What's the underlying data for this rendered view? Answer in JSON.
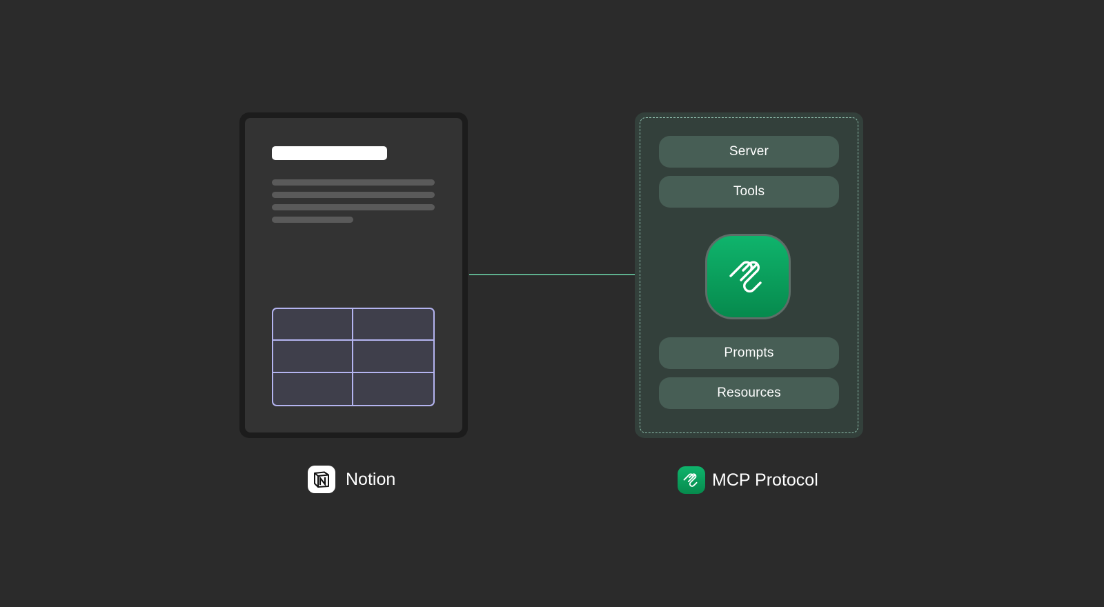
{
  "diagram": {
    "source": {
      "label": "Notion",
      "icon": "notion-logo-icon",
      "document": {
        "table": {
          "rows": 3,
          "columns": 2
        }
      }
    },
    "target": {
      "label": "MCP Protocol",
      "icon": "mcp-logo-icon",
      "components": [
        "Server",
        "Tools",
        "Prompts",
        "Resources"
      ],
      "core_icon": "mcp-logo-icon"
    },
    "connection": {
      "from": "source",
      "to": "target",
      "arrow": "single"
    }
  },
  "colors": {
    "background": "#2b2b2b",
    "accent": "#6fdcb0",
    "mcp_green": "#0fb46c",
    "table_border": "#b4b4f0",
    "pill": "#475e55"
  }
}
